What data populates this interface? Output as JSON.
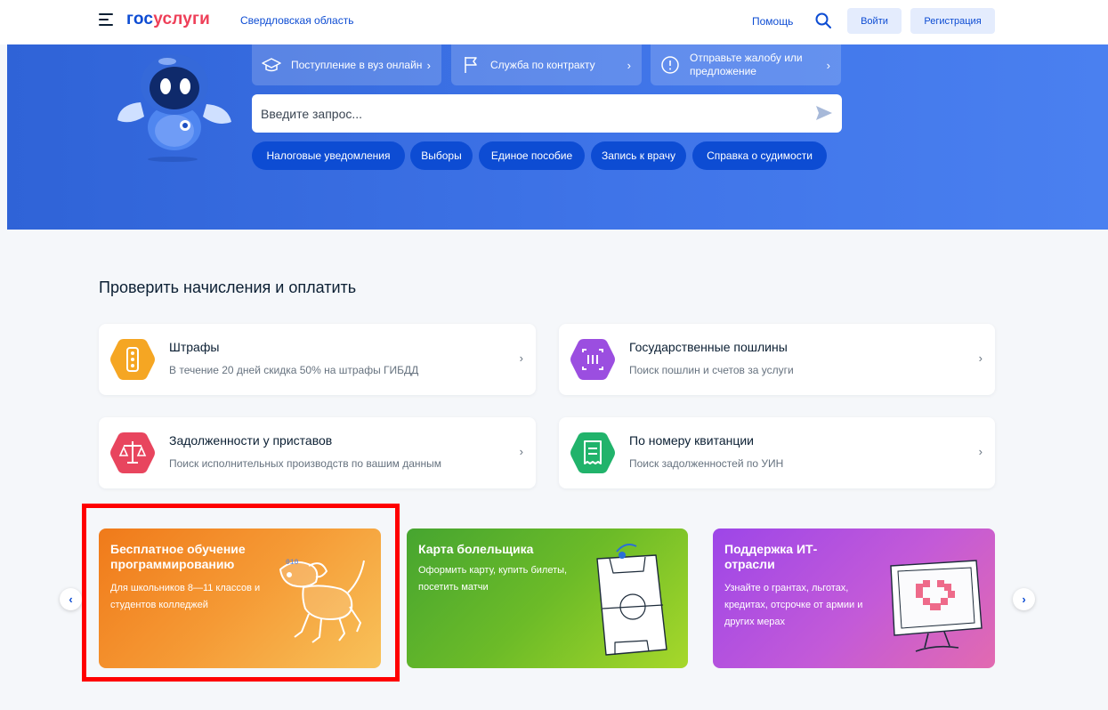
{
  "header": {
    "logo_part1": "гос",
    "logo_part2": "услуги",
    "region": "Свердловская область",
    "help": "Помощь",
    "login": "Войти",
    "register": "Регистрация",
    "icons": [
      "menu-icon",
      "search-icon"
    ]
  },
  "hero": {
    "quick_links": [
      {
        "label": "Поступление в вуз онлайн",
        "icon": "graduation-cap-icon"
      },
      {
        "label": "Служба по контракту",
        "icon": "flag-icon"
      },
      {
        "label": "Отправьте жалобу или предложение",
        "icon": "alert-circle-icon"
      }
    ],
    "search_placeholder": "Введите запрос...",
    "chips": [
      "Налоговые уведомления",
      "Выборы",
      "Единое пособие",
      "Запись к врачу",
      "Справка о судимости"
    ]
  },
  "section": {
    "title": "Проверить начисления и оплатить",
    "services": [
      {
        "title": "Штрафы",
        "desc": "В течение 20 дней скидка 50% на штрафы ГИБДД",
        "icon": "traffic-light-icon",
        "color": "#f5a623"
      },
      {
        "title": "Государственные пошлины",
        "desc": "Поиск пошлин и счетов за услуги",
        "icon": "barcode-scan-icon",
        "color": "#9b4ee0"
      },
      {
        "title": "Задолженности у приставов",
        "desc": "Поиск исполнительных производств по вашим данным",
        "icon": "scales-icon",
        "color": "#e8455e"
      },
      {
        "title": "По номеру квитанции",
        "desc": "Поиск задолженностей по УИН",
        "icon": "receipt-icon",
        "color": "#21b36b"
      }
    ]
  },
  "promos": [
    {
      "title": "Бесплатное обучение программированию",
      "desc": "Для школьников 8—11 классов и студентов колледжей",
      "art": "robot-dog-icon"
    },
    {
      "title": "Карта болельщика",
      "desc": "Оформить карту, купить билеты, посетить матчи",
      "art": "football-field-icon"
    },
    {
      "title": "Поддержка ИТ-отрасли",
      "desc": "Узнайте о грантах, льготах, кредитах, отсрочке от армии и других мерах",
      "art": "monitor-heart-icon"
    }
  ],
  "carousel": {
    "prev": "‹",
    "next": "›"
  }
}
